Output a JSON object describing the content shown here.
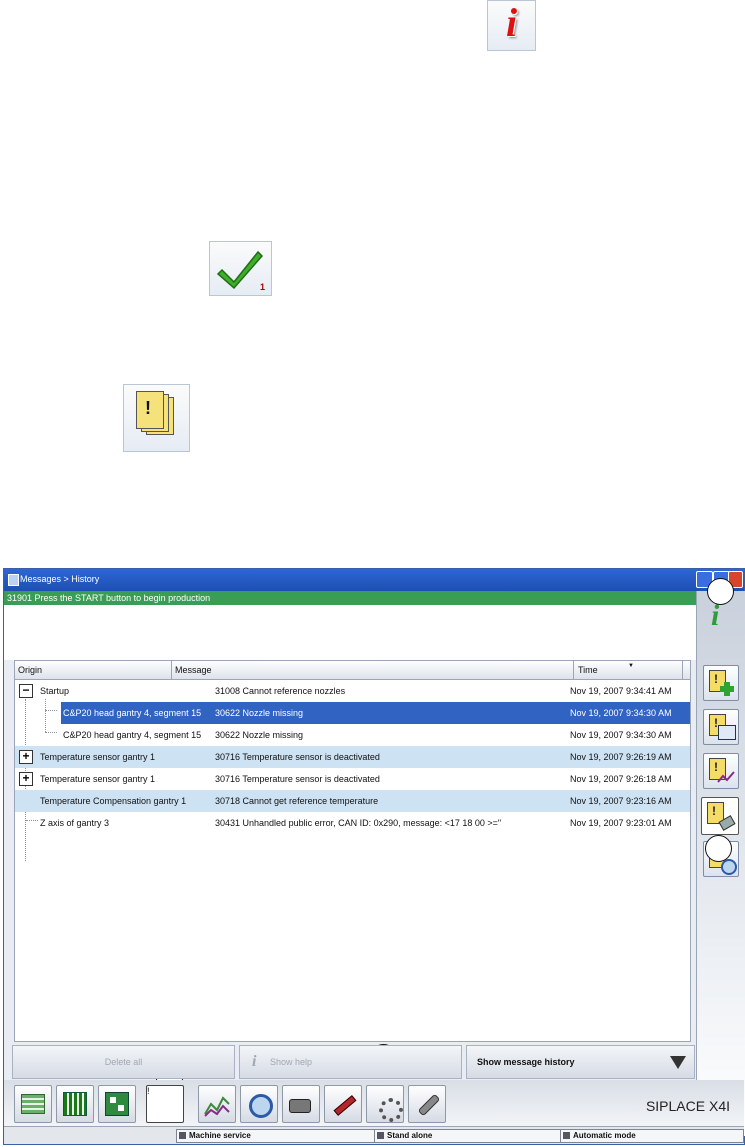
{
  "window": {
    "title": "Messages > History",
    "current_message": "31901 Press the START button to begin production"
  },
  "doc_icons": {
    "check_badge": "1"
  },
  "table": {
    "columns": [
      "Origin",
      "Message",
      "Time"
    ],
    "rows": [
      {
        "origin": "Startup",
        "message": "31008 Cannot reference nozzles",
        "time": "Nov 19, 2007 9:34:41 AM",
        "expander": "−"
      },
      {
        "origin": "C&P20 head gantry 4, segment 15",
        "message": "30622 Nozzle missing",
        "time": "Nov 19, 2007 9:34:30 AM"
      },
      {
        "origin": "C&P20 head gantry 4, segment 15",
        "message": "30622 Nozzle missing",
        "time": "Nov 19, 2007 9:34:30 AM"
      },
      {
        "origin": "Temperature sensor gantry 1",
        "message": "30716 Temperature sensor is deactivated",
        "time": "Nov 19, 2007 9:26:19 AM",
        "expander": "+"
      },
      {
        "origin": "Temperature sensor gantry 1",
        "message": "30716 Temperature sensor is deactivated",
        "time": "Nov 19, 2007 9:26:18 AM",
        "expander": "+"
      },
      {
        "origin": "Temperature Compensation gantry 1",
        "message": "30718 Cannot get reference temperature",
        "time": "Nov 19, 2007 9:23:16 AM"
      },
      {
        "origin": "Z axis of gantry 3",
        "message": "30431 Unhandled public error, CAN ID: 0x290, message: <17 18 00 >=\"",
        "time": "Nov 19, 2007 9:23:01 AM"
      }
    ]
  },
  "buttons": {
    "delete_all": "Delete all",
    "show_help": "Show help",
    "history_dropdown": "Show message history"
  },
  "brand": "SIPLACE X4I",
  "status": {
    "machine_service": "Machine service",
    "stand_alone": "Stand alone",
    "automatic_mode": "Automatic mode"
  },
  "colors": {
    "status_green": "#3a9d55",
    "selection_blue": "#3163c2",
    "alt_row": "#cde3f4",
    "titlebar": "#2e66d8"
  }
}
